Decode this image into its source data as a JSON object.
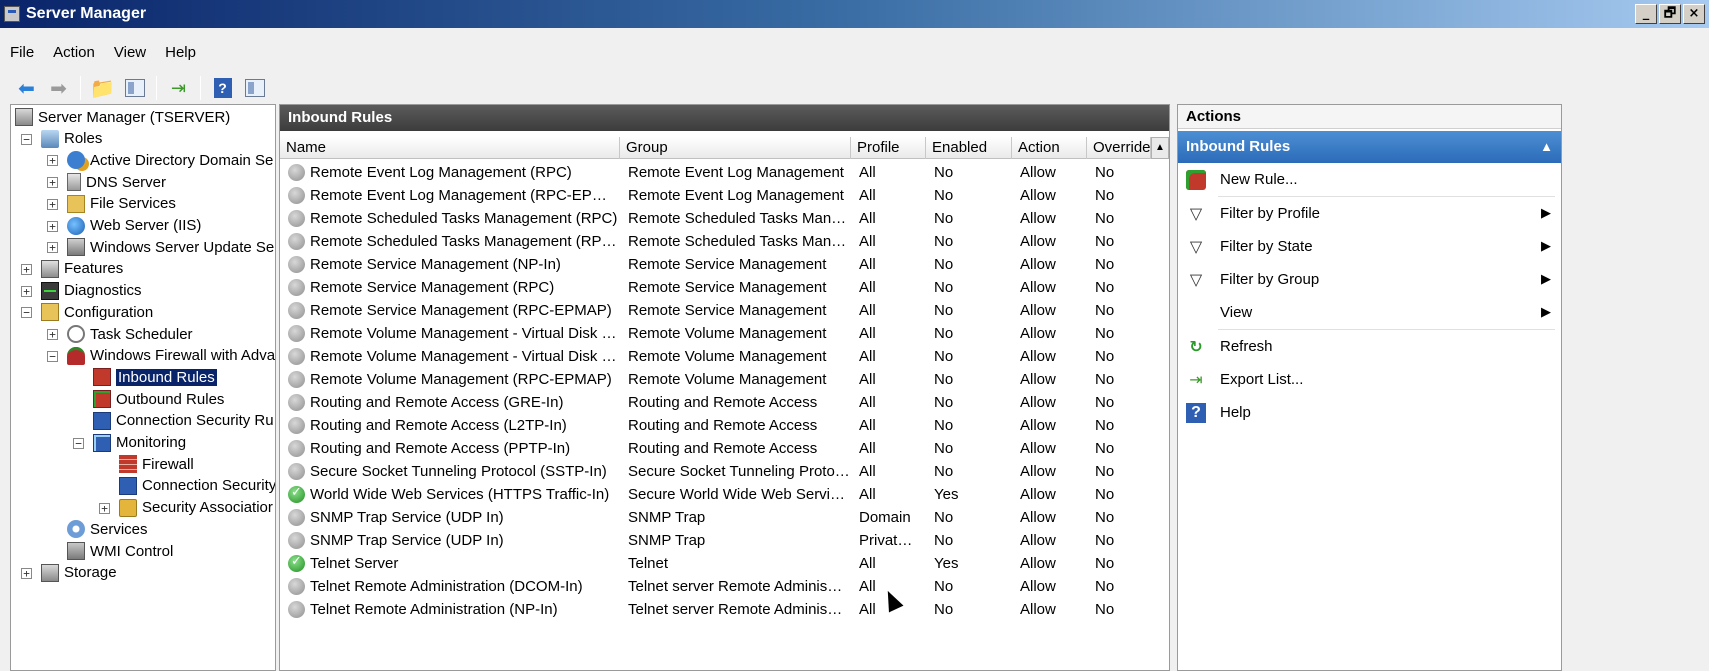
{
  "window": {
    "title": "Server Manager",
    "controls": [
      "_",
      "🗗",
      "×"
    ]
  },
  "menu": [
    "File",
    "Action",
    "View",
    "Help"
  ],
  "toolbar": [
    "back-arrow-icon",
    "forward-arrow-icon",
    "up-folder-icon",
    "show-hide-console-tree-icon",
    "export-list-icon",
    "help-icon",
    "show-hide-action-pane-icon"
  ],
  "tree": [
    {
      "label": "Server Manager (TSERVER)",
      "icon": "server-icon",
      "level": 0,
      "expander": ""
    },
    {
      "label": "Roles",
      "icon": "roles-icon",
      "level": 1,
      "expander": "−"
    },
    {
      "label": "Active Directory Domain Se",
      "icon": "active-directory-icon",
      "level": 2,
      "expander": "+"
    },
    {
      "label": "DNS Server",
      "icon": "dns-server-icon",
      "level": 2,
      "expander": "+"
    },
    {
      "label": "File Services",
      "icon": "file-services-icon",
      "level": 2,
      "expander": "+"
    },
    {
      "label": "Web Server (IIS)",
      "icon": "web-server-icon",
      "level": 2,
      "expander": "+"
    },
    {
      "label": "Windows Server Update Se",
      "icon": "wsus-icon",
      "level": 2,
      "expander": "+"
    },
    {
      "label": "Features",
      "icon": "features-icon",
      "level": 1,
      "expander": "+"
    },
    {
      "label": "Diagnostics",
      "icon": "diagnostics-icon",
      "level": 1,
      "expander": "+"
    },
    {
      "label": "Configuration",
      "icon": "configuration-icon",
      "level": 1,
      "expander": "−"
    },
    {
      "label": "Task Scheduler",
      "icon": "task-scheduler-icon",
      "level": 2,
      "expander": "+"
    },
    {
      "label": "Windows Firewall with Adva",
      "icon": "firewall-icon",
      "level": 2,
      "expander": "−"
    },
    {
      "label": "Inbound Rules",
      "icon": "inbound-rules-icon",
      "level": 3,
      "expander": "",
      "selected": true
    },
    {
      "label": "Outbound Rules",
      "icon": "outbound-rules-icon",
      "level": 3,
      "expander": ""
    },
    {
      "label": "Connection Security Ru",
      "icon": "connection-security-icon",
      "level": 3,
      "expander": ""
    },
    {
      "label": "Monitoring",
      "icon": "monitoring-icon",
      "level": 3,
      "expander": "−"
    },
    {
      "label": "Firewall",
      "icon": "firewall-wall-icon",
      "level": 4,
      "expander": ""
    },
    {
      "label": "Connection Security",
      "icon": "connection-security-icon",
      "level": 4,
      "expander": ""
    },
    {
      "label": "Security Associatior",
      "icon": "security-associations-icon",
      "level": 4,
      "expander": "+"
    },
    {
      "label": "Services",
      "icon": "services-gear-icon",
      "level": 2,
      "expander": ""
    },
    {
      "label": "WMI Control",
      "icon": "wmi-control-icon",
      "level": 2,
      "expander": ""
    },
    {
      "label": "Storage",
      "icon": "storage-icon",
      "level": 1,
      "expander": "+"
    }
  ],
  "center": {
    "title": "Inbound Rules",
    "columns": [
      "Name",
      "Group",
      "Profile",
      "Enabled",
      "Action",
      "Override"
    ],
    "rows": [
      {
        "enabled_icon": false,
        "name": "Remote Event Log Management (RPC)",
        "group": "Remote Event Log Management",
        "profile": "All",
        "enabled": "No",
        "action": "Allow",
        "override": "No"
      },
      {
        "enabled_icon": false,
        "name": "Remote Event Log Management (RPC-EPMAP)",
        "group": "Remote Event Log Management",
        "profile": "All",
        "enabled": "No",
        "action": "Allow",
        "override": "No"
      },
      {
        "enabled_icon": false,
        "name": "Remote Scheduled Tasks Management (RPC)",
        "group": "Remote Scheduled Tasks Man…",
        "profile": "All",
        "enabled": "No",
        "action": "Allow",
        "override": "No"
      },
      {
        "enabled_icon": false,
        "name": "Remote Scheduled Tasks Management (RPC…",
        "group": "Remote Scheduled Tasks Man…",
        "profile": "All",
        "enabled": "No",
        "action": "Allow",
        "override": "No"
      },
      {
        "enabled_icon": false,
        "name": "Remote Service Management (NP-In)",
        "group": "Remote Service Management",
        "profile": "All",
        "enabled": "No",
        "action": "Allow",
        "override": "No"
      },
      {
        "enabled_icon": false,
        "name": "Remote Service Management (RPC)",
        "group": "Remote Service Management",
        "profile": "All",
        "enabled": "No",
        "action": "Allow",
        "override": "No"
      },
      {
        "enabled_icon": false,
        "name": "Remote Service Management (RPC-EPMAP)",
        "group": "Remote Service Management",
        "profile": "All",
        "enabled": "No",
        "action": "Allow",
        "override": "No"
      },
      {
        "enabled_icon": false,
        "name": "Remote Volume Management - Virtual Disk S…",
        "group": "Remote Volume Management",
        "profile": "All",
        "enabled": "No",
        "action": "Allow",
        "override": "No"
      },
      {
        "enabled_icon": false,
        "name": "Remote Volume Management - Virtual Disk S…",
        "group": "Remote Volume Management",
        "profile": "All",
        "enabled": "No",
        "action": "Allow",
        "override": "No"
      },
      {
        "enabled_icon": false,
        "name": "Remote Volume Management (RPC-EPMAP)",
        "group": "Remote Volume Management",
        "profile": "All",
        "enabled": "No",
        "action": "Allow",
        "override": "No"
      },
      {
        "enabled_icon": false,
        "name": "Routing and Remote Access (GRE-In)",
        "group": "Routing and Remote Access",
        "profile": "All",
        "enabled": "No",
        "action": "Allow",
        "override": "No"
      },
      {
        "enabled_icon": false,
        "name": "Routing and Remote Access (L2TP-In)",
        "group": "Routing and Remote Access",
        "profile": "All",
        "enabled": "No",
        "action": "Allow",
        "override": "No"
      },
      {
        "enabled_icon": false,
        "name": "Routing and Remote Access (PPTP-In)",
        "group": "Routing and Remote Access",
        "profile": "All",
        "enabled": "No",
        "action": "Allow",
        "override": "No"
      },
      {
        "enabled_icon": false,
        "name": "Secure Socket Tunneling Protocol (SSTP-In)",
        "group": "Secure Socket Tunneling Proto…",
        "profile": "All",
        "enabled": "No",
        "action": "Allow",
        "override": "No"
      },
      {
        "enabled_icon": true,
        "name": "World Wide Web Services (HTTPS Traffic-In)",
        "group": "Secure World Wide Web Servi…",
        "profile": "All",
        "enabled": "Yes",
        "action": "Allow",
        "override": "No"
      },
      {
        "enabled_icon": false,
        "name": "SNMP Trap Service (UDP In)",
        "group": "SNMP Trap",
        "profile": "Domain",
        "enabled": "No",
        "action": "Allow",
        "override": "No"
      },
      {
        "enabled_icon": false,
        "name": "SNMP Trap Service (UDP In)",
        "group": "SNMP Trap",
        "profile": "Privat…",
        "enabled": "No",
        "action": "Allow",
        "override": "No"
      },
      {
        "enabled_icon": true,
        "name": "Telnet Server",
        "group": "Telnet",
        "profile": "All",
        "enabled": "Yes",
        "action": "Allow",
        "override": "No"
      },
      {
        "enabled_icon": false,
        "name": "Telnet Remote Administration (DCOM-In)",
        "group": "Telnet server Remote Adminis…",
        "profile": "All",
        "enabled": "No",
        "action": "Allow",
        "override": "No"
      },
      {
        "enabled_icon": false,
        "name": "Telnet Remote Administration (NP-In)",
        "group": "Telnet server Remote Adminis…",
        "profile": "All",
        "enabled": "No",
        "action": "Allow",
        "override": "No"
      }
    ]
  },
  "actions": {
    "header": "Actions",
    "section": "Inbound Rules",
    "items": [
      {
        "label": "New Rule...",
        "icon": "new-rule-icon",
        "submenu": false
      },
      {
        "label": "Filter by Profile",
        "icon": "filter-icon",
        "submenu": true
      },
      {
        "label": "Filter by State",
        "icon": "filter-icon",
        "submenu": true
      },
      {
        "label": "Filter by Group",
        "icon": "filter-icon",
        "submenu": true
      },
      {
        "label": "View",
        "icon": "",
        "submenu": true
      },
      {
        "label": "Refresh",
        "icon": "refresh-icon",
        "submenu": false
      },
      {
        "label": "Export List...",
        "icon": "export-list-icon",
        "submenu": false
      },
      {
        "label": "Help",
        "icon": "help-icon",
        "submenu": false
      }
    ]
  }
}
